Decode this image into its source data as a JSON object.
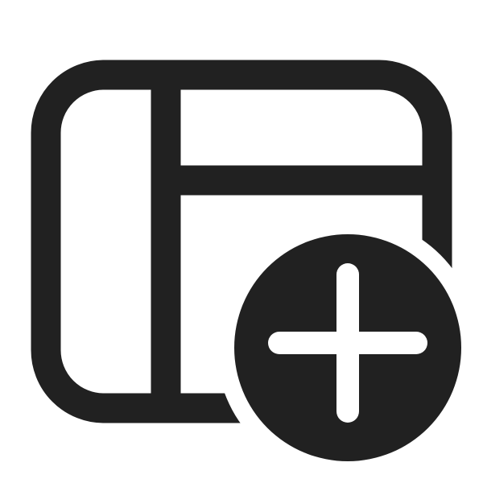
{
  "icon": {
    "name": "layout-sidebar-header-add-icon",
    "colors": {
      "background": "#ffffff",
      "stroke": "#212121",
      "badge_fill": "#212121",
      "badge_symbol": "#ffffff"
    },
    "badge": {
      "name": "add-badge-icon"
    }
  }
}
